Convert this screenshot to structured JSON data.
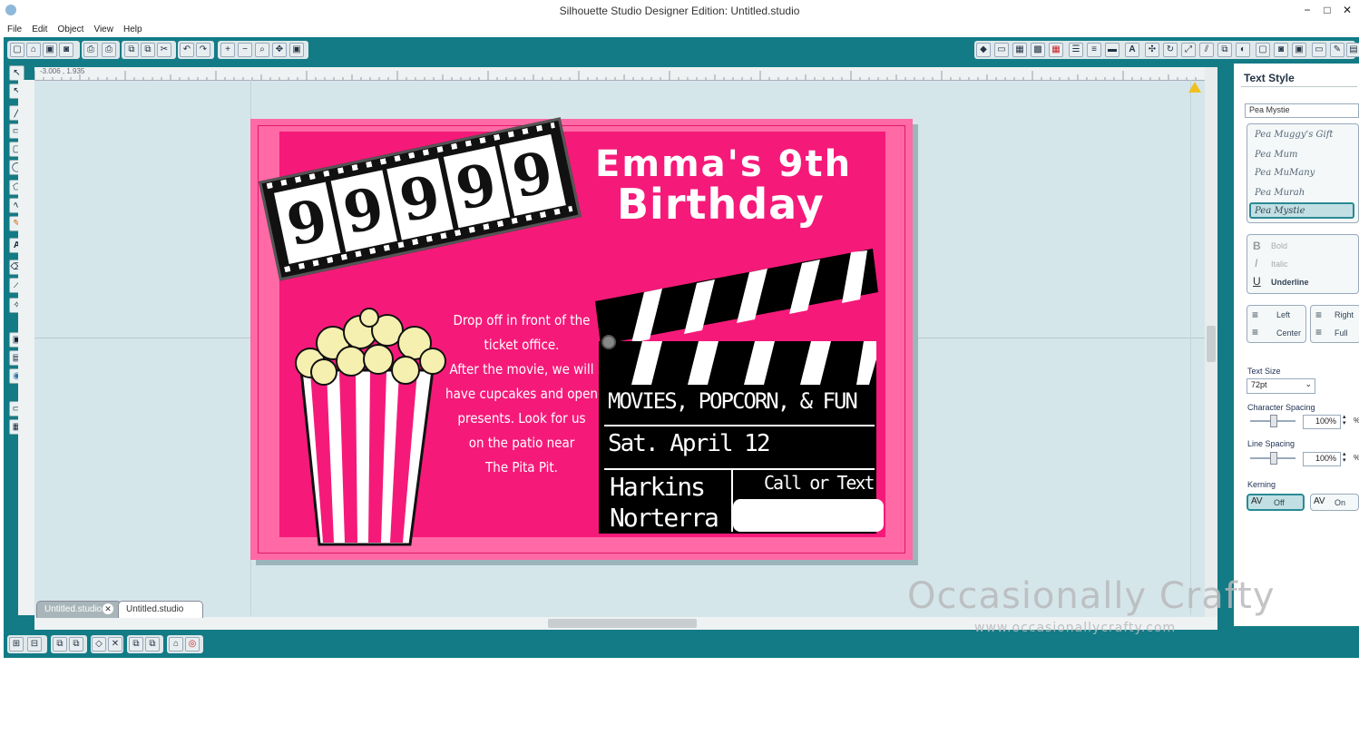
{
  "window": {
    "title": "Silhouette Studio Designer Edition: Untitled.studio",
    "minimize": "−",
    "maximize": "□",
    "close": "✕"
  },
  "menu": [
    "File",
    "Edit",
    "Object",
    "View",
    "Help"
  ],
  "ruler": {
    "coords": "-3.006 , 1.935"
  },
  "tabs": [
    {
      "label": "Untitled.studio"
    },
    {
      "label": "Untitled.studio"
    }
  ],
  "invitation": {
    "reel_digits": [
      "9",
      "9",
      "9",
      "9",
      "9"
    ],
    "title_line1": "Emma's 9th",
    "title_line2": "Birthday",
    "details": [
      "Drop off in front of the",
      "ticket office.",
      "After the movie, we will",
      "have cupcakes and open",
      "presents. Look for us",
      "on the patio near",
      "The Pita Pit."
    ],
    "clapper_line1": "MOVIES, POPCORN, & FUN",
    "clapper_line2": "Sat. April 12",
    "clapper_venue1": "Harkins",
    "clapper_venue2": "Norterra",
    "clapper_contact": "Call or Text"
  },
  "text_style": {
    "heading": "Text Style",
    "font_value": "Pea Mystie",
    "fonts": [
      "Pea Muggy's Gift",
      "Pea Mum",
      "Pea MuMany",
      "Pea Murah",
      "Pea Mystie"
    ],
    "bold": "Bold",
    "italic": "Italic",
    "underline": "Underline",
    "align_left": "Left",
    "align_center": "Center",
    "align_right": "Right",
    "align_full": "Full",
    "text_size_label": "Text Size",
    "text_size_value": "72pt",
    "char_spacing_label": "Character Spacing",
    "char_spacing_value": "100%",
    "line_spacing_label": "Line Spacing",
    "line_spacing_value": "100%",
    "kerning_label": "Kerning",
    "kerning_off": "Off",
    "kerning_on": "On",
    "pct": "%"
  },
  "watermark": {
    "line1": "Occasionally Crafty",
    "line2": "www.occasionallycrafty.com"
  },
  "colors": {
    "frame_teal": "#127b86",
    "canvas": "#d5e6ea",
    "card_pink": "#f51a79",
    "card_border_pink": "#ff69a6"
  }
}
